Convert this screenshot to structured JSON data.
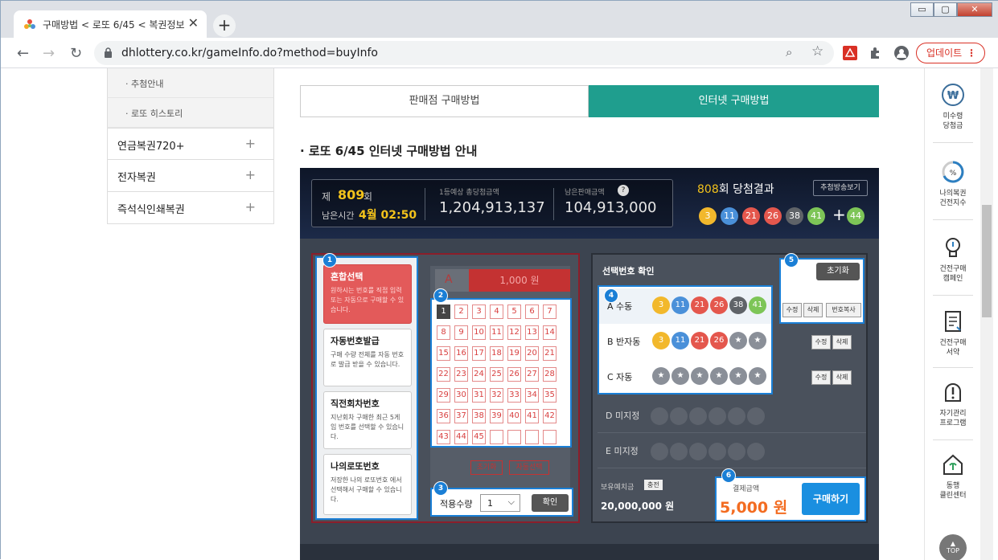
{
  "browser": {
    "tab_title": "구매방법 < 로또 6/45 < 복권정보",
    "tab_close": "✕",
    "new_tab": "+",
    "url": "dhlottery.co.kr/gameInfo.do?method=buyInfo",
    "update_label": "업데이트",
    "update_dots": "⋮",
    "win_min": "▭",
    "win_max": "▢",
    "win_close": "✕"
  },
  "left_menu": {
    "subitems": [
      "추첨안내",
      "로또 히스토리"
    ],
    "items": [
      {
        "label": "연금복권720+",
        "plus": "+"
      },
      {
        "label": "전자복권",
        "plus": "+"
      },
      {
        "label": "즉석식인쇄복권",
        "plus": "+"
      }
    ]
  },
  "tabs": {
    "store": "판매점 구매방법",
    "internet": "인터넷 구매방법"
  },
  "heading": "로또 6/45 인터넷 구매방법 안내",
  "game": {
    "round_prefix": "제",
    "round": "809",
    "round_suffix": "회",
    "remain_label": "남은시간",
    "remain_value": "4월 02:50",
    "jackpot_label": "1등예상 총당첨금액",
    "jackpot_value": "1,204,913,137",
    "sales_label": "남은판매금액",
    "sales_value": "104,913,000",
    "result_round": "808",
    "result_label": "회 당첨결과",
    "result_btn": "추첨방송보기",
    "result_balls": [
      "3",
      "11",
      "21",
      "26",
      "38",
      "41"
    ],
    "bonus_plus": "+",
    "bonus_ball": "44",
    "colors": {
      "yellow": "#f2b82c",
      "blue": "#4a90d9",
      "red": "#e4574d",
      "gray": "#5f6368",
      "green": "#7dc557"
    },
    "options": [
      {
        "title": "혼합선택",
        "desc": "원하시는 번호를 직접 입력 또는 자동으로 구매할 수 있습니다."
      },
      {
        "title": "자동번호발급",
        "desc": "구매 수량 전체를 자동 번호로 발급 받을 수 있습니다."
      },
      {
        "title": "직전회차번호",
        "desc": "지난회차 구매한 최근 5게임 번호를 선택할 수 있습니다."
      },
      {
        "title": "나의로또번호",
        "desc": "저장한 나의 로또번호 에서 선택해서 구매할 수 있습니다."
      }
    ],
    "slot_label": "A",
    "slot_price": "1,000 원",
    "numbers": [
      "1",
      "2",
      "3",
      "4",
      "5",
      "6",
      "7",
      "8",
      "9",
      "10",
      "11",
      "12",
      "13",
      "14",
      "15",
      "16",
      "17",
      "18",
      "19",
      "20",
      "21",
      "22",
      "23",
      "24",
      "25",
      "26",
      "27",
      "28",
      "29",
      "30",
      "31",
      "32",
      "33",
      "34",
      "35",
      "36",
      "37",
      "38",
      "39",
      "40",
      "41",
      "42",
      "43",
      "44",
      "45"
    ],
    "selected_number": "1",
    "grid_reset": "초기화",
    "grid_auto": "자동선택",
    "qty_label": "적용수량",
    "qty_value": "1",
    "qty_arrow": "⌵",
    "qty_ok": "확인",
    "confirm_title": "선택번호 확인",
    "rows": [
      {
        "label": "A 수동",
        "balls": [
          "3",
          "11",
          "21",
          "26",
          "38",
          "41"
        ]
      },
      {
        "label": "B 반자동",
        "balls": [
          "3",
          "11",
          "21",
          "26",
          "★",
          "★"
        ]
      },
      {
        "label": "C 자동",
        "balls": [
          "★",
          "★",
          "★",
          "★",
          "★",
          "★"
        ]
      }
    ],
    "empty_rows": [
      "D 미지정",
      "E 미지정"
    ],
    "reset_btn": "초기화",
    "edit_btn": "수정",
    "delete_btn": "삭제",
    "copy_btn": "번호복사",
    "balance_label": "보유예치금",
    "charge_btn": "충전",
    "balance_value": "20,000,000 원",
    "pay_label": "결제금액",
    "pay_value": "5,000 원",
    "buy_btn": "구매하기",
    "badges": [
      "1",
      "2",
      "3",
      "4",
      "5",
      "6"
    ]
  },
  "right_sidebar": [
    {
      "icon": "won-icon",
      "label": "미수령\n당첨금"
    },
    {
      "icon": "gauge-icon",
      "label": "나의복권\n건전지수"
    },
    {
      "icon": "bulb-icon",
      "label": "건전구매\n캠페인"
    },
    {
      "icon": "pledge-icon",
      "label": "건전구매\n서약"
    },
    {
      "icon": "alert-icon",
      "label": "자기관리\n프로그램"
    },
    {
      "icon": "house-icon",
      "label": "동행\n클린센터"
    }
  ],
  "top_label": "TOP"
}
